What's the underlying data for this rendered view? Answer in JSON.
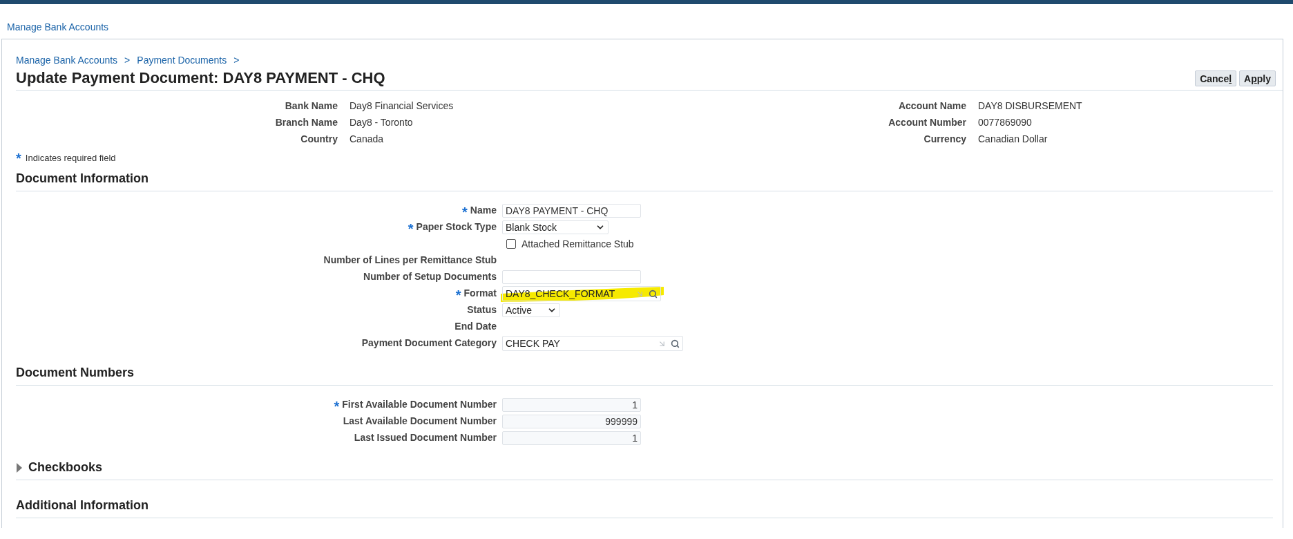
{
  "top_link": "Manage Bank Accounts",
  "breadcrumbs": [
    {
      "label": "Manage Bank Accounts",
      "separator": ">"
    },
    {
      "label": "Payment Documents",
      "separator": ">"
    }
  ],
  "title": "Update Payment Document: DAY8 PAYMENT - CHQ",
  "buttons": [
    {
      "before": "Cance",
      "key": "l"
    },
    {
      "before": "A",
      "key": "p",
      "after": "ply"
    }
  ],
  "bank_info": [
    {
      "label": "Bank Name",
      "value": "Day8 Financial Services",
      "label2": "Account Name",
      "value2": "DAY8 DISBURSEMENT"
    },
    {
      "label": "Branch Name",
      "value": "Day8 - Toronto",
      "label2": "Account Number",
      "value2": "0077869090"
    },
    {
      "label": "Country",
      "value": "Canada",
      "label2": "Currency",
      "value2": "Canadian Dollar"
    }
  ],
  "required_note": {
    "mark": "*",
    "text": "Indicates required field"
  },
  "sections": [
    {
      "title": "Document Information",
      "kind": "plain",
      "rows": [
        {
          "kind": "text",
          "label": "Name",
          "required": true,
          "value": "DAY8 PAYMENT - CHQ"
        },
        {
          "kind": "select",
          "label": "Paper Stock Type",
          "required": true,
          "value": "Blank Stock"
        },
        {
          "kind": "checkbox",
          "text": "Attached Remittance Stub",
          "checked": false
        },
        {
          "kind": "display",
          "label": "Number of Lines per Remittance Stub",
          "required": false
        },
        {
          "kind": "text",
          "label": "Number of Setup Documents",
          "required": false
        },
        {
          "kind": "lookup",
          "label": "Format",
          "required": true,
          "value": "DAY8_CHECK_FORMAT",
          "highlighted": true
        },
        {
          "kind": "select",
          "label": "Status",
          "required": false,
          "value": "Active"
        },
        {
          "kind": "display",
          "label": "End Date",
          "required": false
        },
        {
          "kind": "lookup",
          "label": "Payment Document Category",
          "required": false,
          "value": "CHECK PAY"
        }
      ]
    },
    {
      "title": "Document Numbers",
      "kind": "plain",
      "rows": [
        {
          "kind": "number",
          "label": "First Available Document Number",
          "required": true,
          "value": "1"
        },
        {
          "kind": "number",
          "label": "Last Available Document Number",
          "required": false,
          "value": "999999"
        },
        {
          "kind": "number",
          "label": "Last Issued Document Number",
          "required": false,
          "value": "1"
        }
      ]
    },
    {
      "title": "Checkbooks",
      "kind": "collapsible",
      "expanded": false
    },
    {
      "title": "Additional Information",
      "kind": "plain"
    }
  ]
}
